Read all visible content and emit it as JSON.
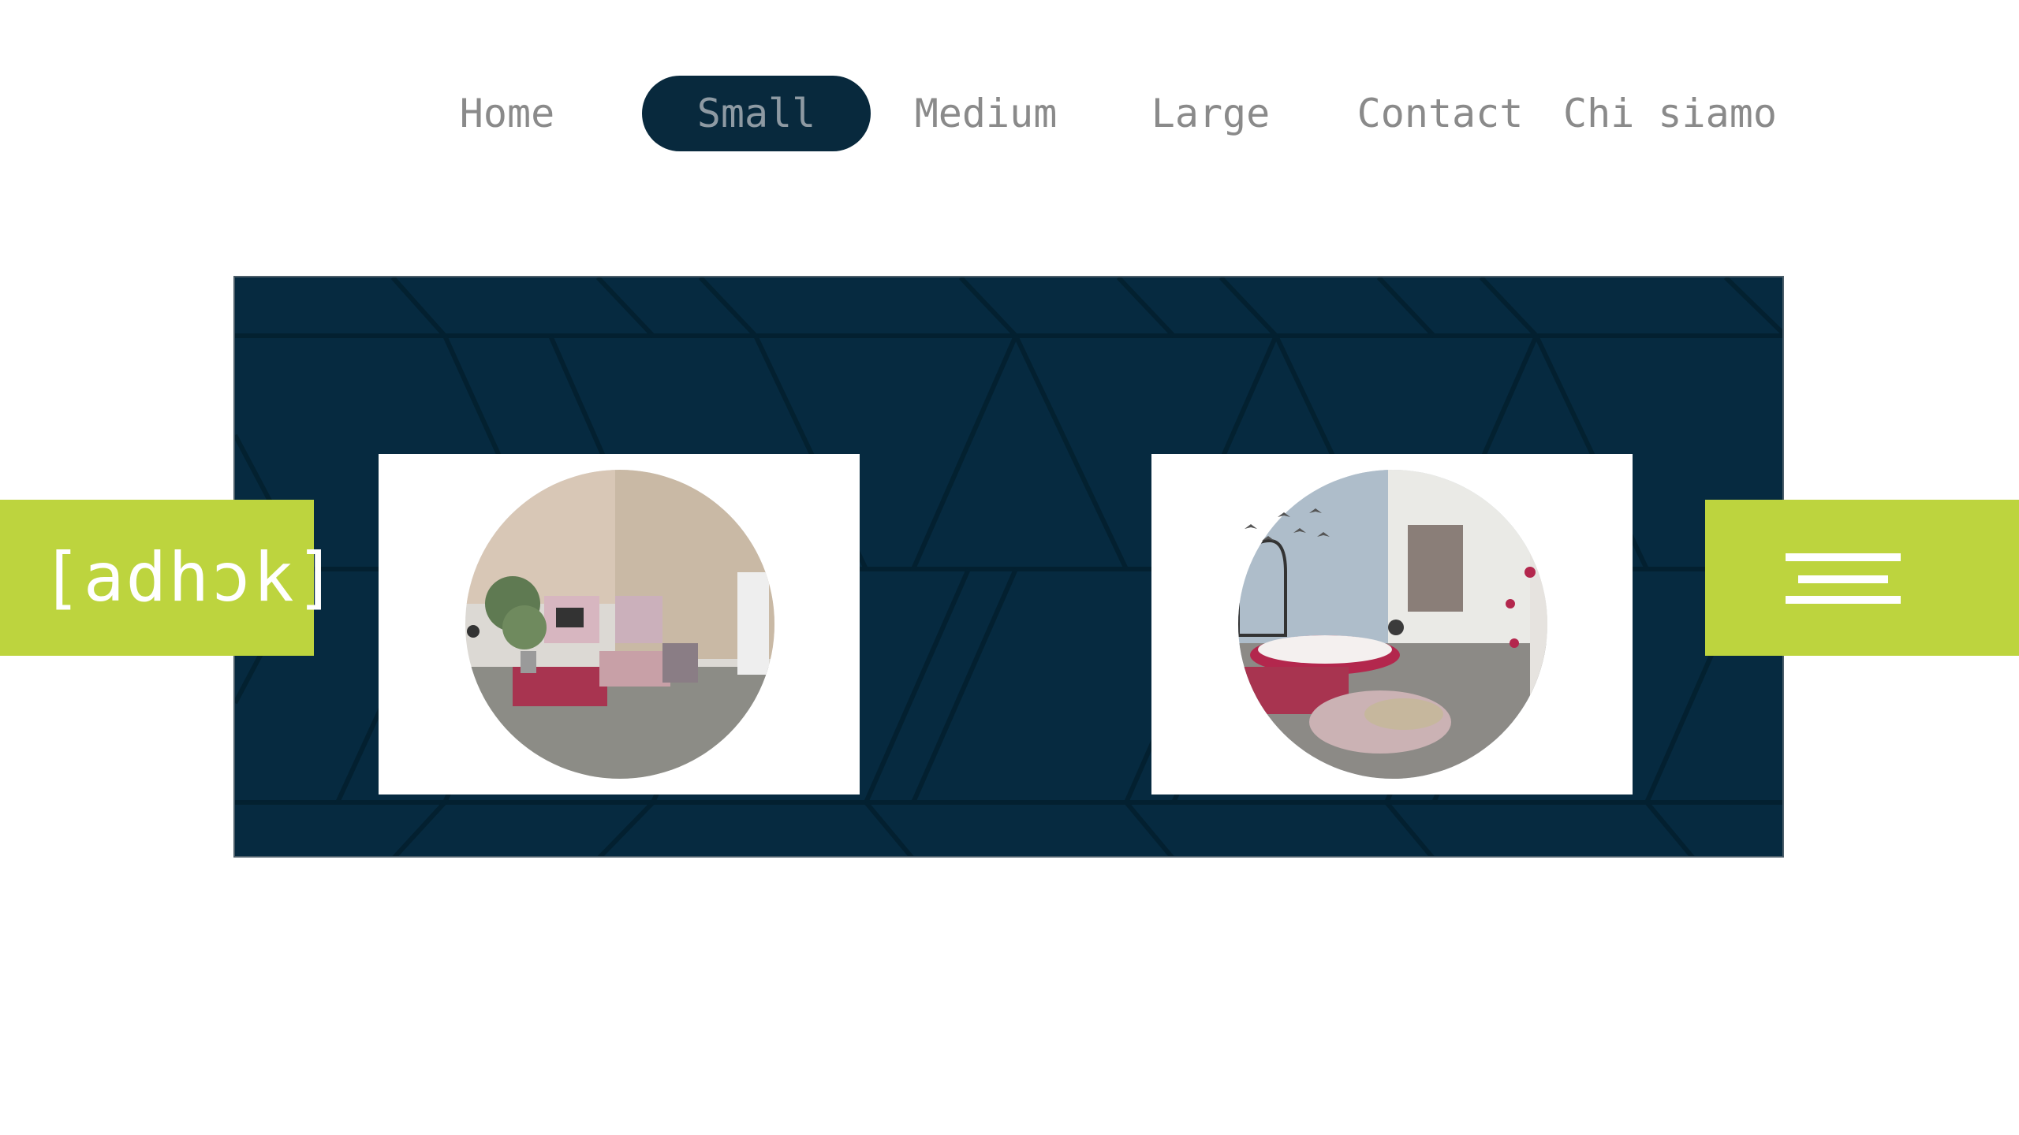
{
  "nav": {
    "items": [
      {
        "label": "Home",
        "active": false
      },
      {
        "label": "Small",
        "active": true
      },
      {
        "label": "Medium",
        "active": false
      },
      {
        "label": "Large",
        "active": false
      },
      {
        "label": "Contact",
        "active": false
      },
      {
        "label": "Chi siamo",
        "active": false
      }
    ]
  },
  "logo": {
    "text": "[adhɔk]"
  },
  "menu": {
    "icon": "hamburger-menu-icon"
  },
  "gallery": {
    "images": [
      {
        "description_icon": "living-room-illustration"
      },
      {
        "description_icon": "bedroom-illustration"
      }
    ]
  },
  "colors": {
    "navy": "#062a40",
    "accent_green": "#bdd43e",
    "nav_text": "#8a8a8a",
    "white": "#ffffff"
  }
}
